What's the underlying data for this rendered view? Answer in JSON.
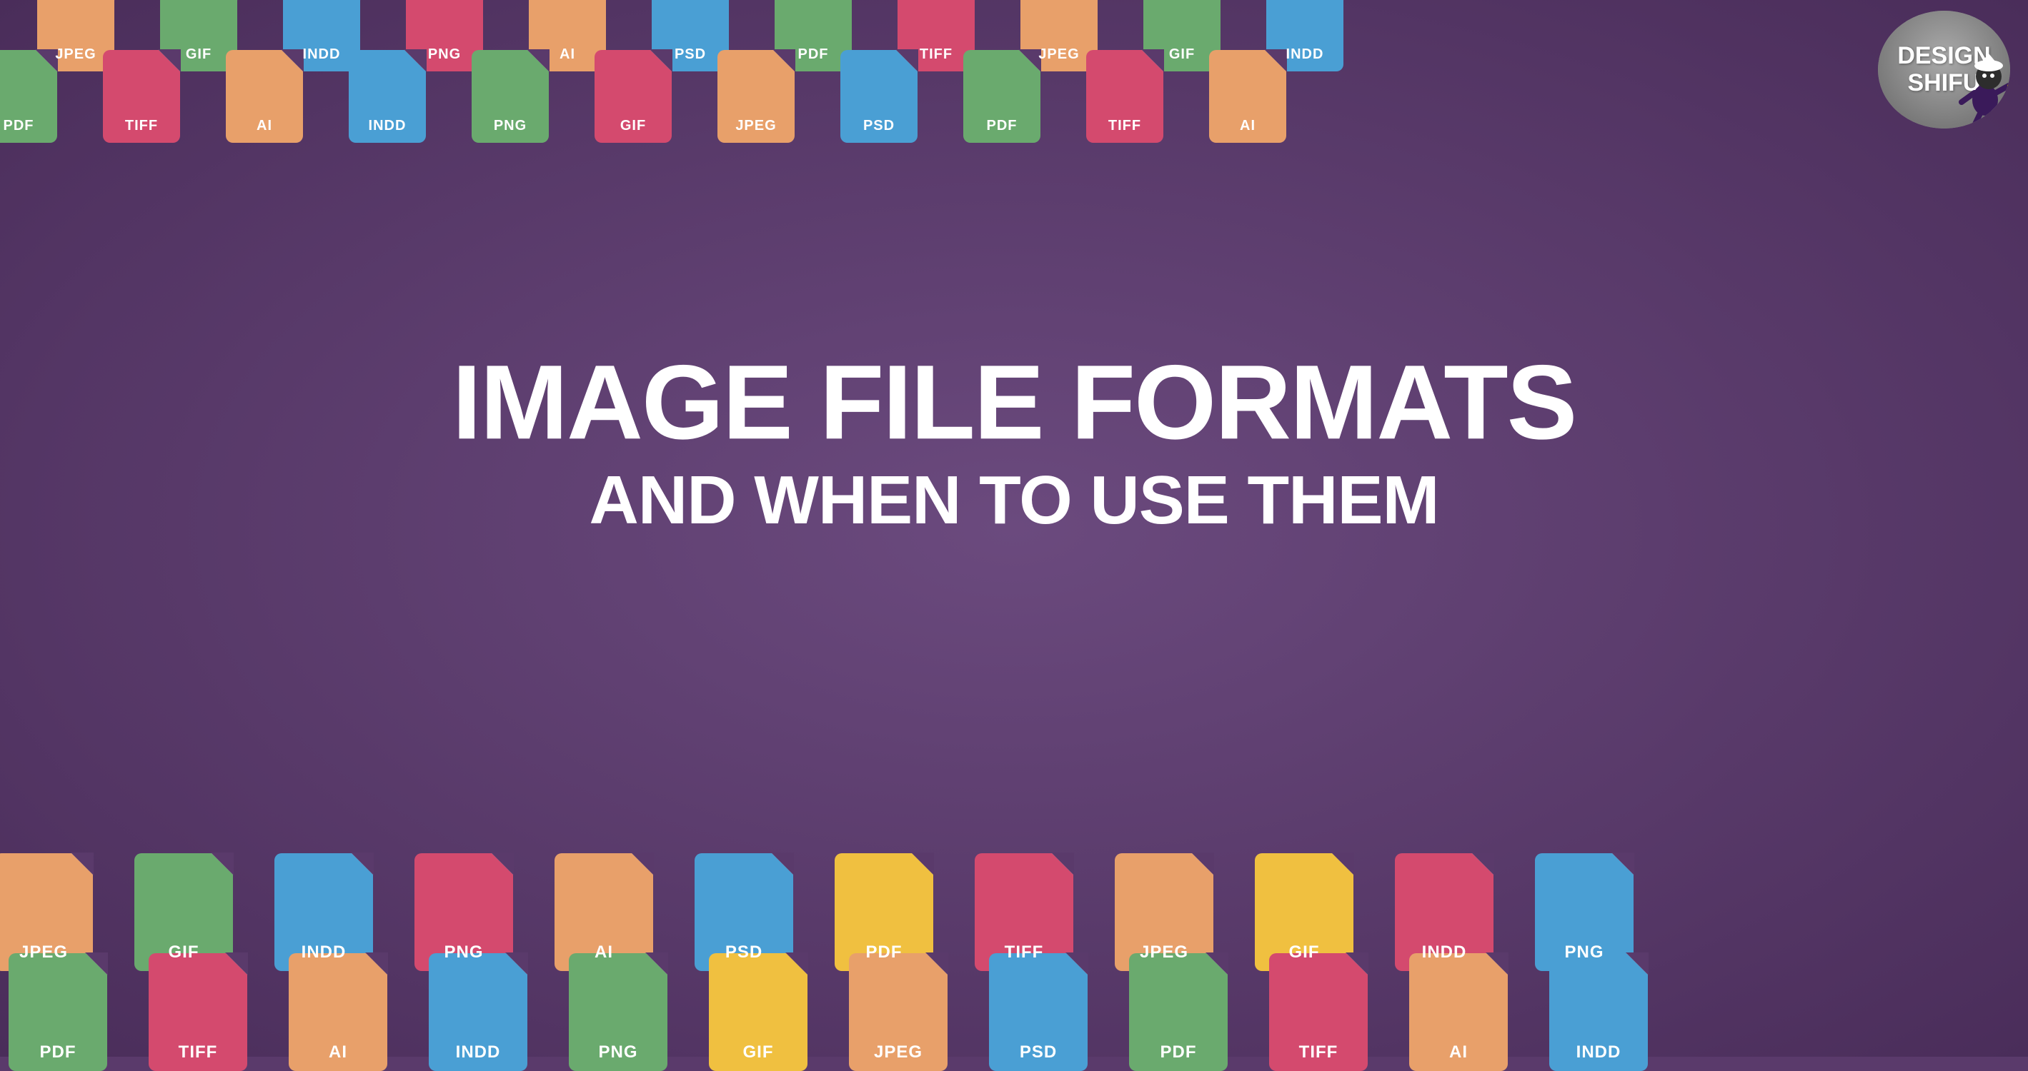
{
  "page": {
    "title": "Image File Formats And When To Use Them",
    "background_color": "#5a3a6b"
  },
  "main_heading": "IMAGE FILE FORMATS",
  "sub_heading": "AND WHEN TO USE THEM",
  "logo": {
    "brand": "DESIGN SHIFU",
    "line1": "DESIGN",
    "line2": "SHIFU"
  },
  "rows": {
    "row1": [
      "JPEG",
      "GIF",
      "INDD",
      "PNG",
      "AI",
      "PSD",
      "PDF",
      "TIFF",
      "JPEG",
      "GIF"
    ],
    "row2": [
      "PDF",
      "TIFF",
      "AI",
      "INDD",
      "PNG",
      "GIF",
      "JPEG",
      "PSD",
      "PDF",
      "TIFF"
    ],
    "row3": [
      "JPEG",
      "GIF",
      "INDD",
      "PNG",
      "AI",
      "PSD",
      "PDF",
      "TIFF",
      "JPEG",
      "GIF",
      "INDD",
      "PNG"
    ],
    "row4": [
      "PDF",
      "TIFF",
      "AI",
      "INDD",
      "PNG",
      "GIF",
      "JPEG",
      "PSD",
      "PDF",
      "TIFF",
      "AI",
      "INDD"
    ]
  },
  "colors": {
    "JPEG": "#e8a06a",
    "GIF": "#6aaa6e",
    "INDD": "#4a9fd4",
    "PNG": "#d44a6e",
    "AI": "#e8a06a",
    "PSD": "#4a9fd4",
    "PDF": "#6aaa6e",
    "TIFF": "#d44a6e",
    "PDF2": "#f0c040"
  }
}
